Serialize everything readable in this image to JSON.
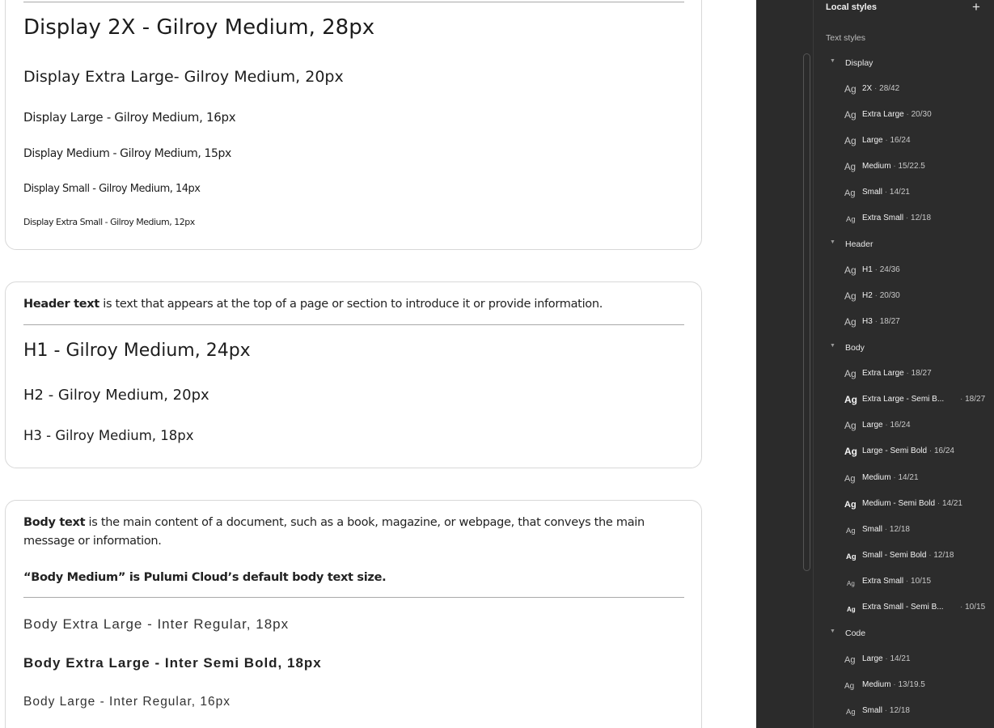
{
  "canvas": {
    "display_lines": [
      "Display 2X - Gilroy Medium, 28px",
      "Display Extra Large- Gilroy Medium, 20px",
      "Display Large - Gilroy Medium, 16px",
      "Display Medium - Gilroy Medium, 15px",
      "Display Small - Gilroy Medium, 14px",
      "Display Extra Small - Gilroy Medium, 12px"
    ],
    "header_intro_bold": "Header text",
    "header_intro_rest": " is text that appears at the top of a page or section to introduce it or provide information.",
    "header_lines": [
      "H1 - Gilroy Medium, 24px",
      "H2 - Gilroy Medium, 20px",
      "H3 - Gilroy Medium, 18px"
    ],
    "body_intro_bold": "Body text",
    "body_intro_rest": " is the main content of a document, such as a book, magazine, or webpage, that conveys the main message or information.",
    "body_note": "“Body Medium” is Pulumi Cloud’s default body text size.",
    "body_lines": [
      "Body Extra Large - Inter Regular, 18px",
      "Body Extra Large - Inter Semi Bold, 18px",
      "Body Large - Inter Regular, 16px"
    ]
  },
  "panel": {
    "title": "Local styles",
    "add_icon": "+",
    "section": "Text styles",
    "ag": "Ag",
    "separator": "·",
    "groups": {
      "display": "Display",
      "header": "Header",
      "body": "Body",
      "code": "Code"
    },
    "display_items": [
      {
        "name": "2X",
        "spec": "28/42"
      },
      {
        "name": "Extra Large",
        "spec": "20/30"
      },
      {
        "name": "Large",
        "spec": "16/24"
      },
      {
        "name": "Medium",
        "spec": "15/22.5"
      },
      {
        "name": "Small",
        "spec": "14/21"
      },
      {
        "name": "Extra Small",
        "spec": "12/18"
      }
    ],
    "header_items": [
      {
        "name": "H1",
        "spec": "24/36"
      },
      {
        "name": "H2",
        "spec": "20/30"
      },
      {
        "name": "H3",
        "spec": "18/27"
      }
    ],
    "body_items": [
      {
        "name": "Extra Large",
        "spec": "18/27"
      },
      {
        "name": "Extra Large - Semi B...",
        "spec": "18/27"
      },
      {
        "name": "Large",
        "spec": "16/24"
      },
      {
        "name": "Large - Semi Bold",
        "spec": "16/24"
      },
      {
        "name": "Medium",
        "spec": "14/21"
      },
      {
        "name": "Medium - Semi Bold",
        "spec": "14/21"
      },
      {
        "name": "Small",
        "spec": "12/18"
      },
      {
        "name": "Small - Semi Bold",
        "spec": "12/18"
      },
      {
        "name": "Extra Small",
        "spec": "10/15"
      },
      {
        "name": "Extra Small - Semi B...",
        "spec": "10/15"
      }
    ],
    "code_items": [
      {
        "name": "Large",
        "spec": "14/21"
      },
      {
        "name": "Medium",
        "spec": "13/19.5"
      },
      {
        "name": "Small",
        "spec": "12/18"
      }
    ]
  }
}
